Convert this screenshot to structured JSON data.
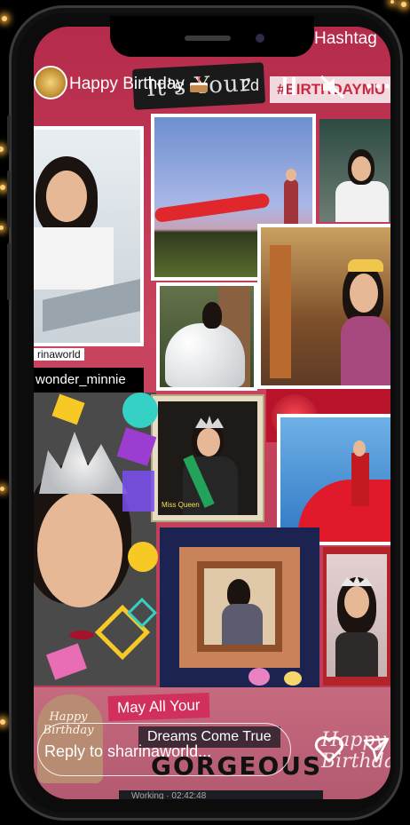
{
  "story": {
    "title": "Happy Birthday",
    "time": "2d",
    "hashtag_sticker": "#BIRTHDAYMU",
    "hashtag_peek": "Hashtag",
    "sticker_heading": "It's Your",
    "tag_user_1": "rinaworld",
    "tag_user_2": "wonder_minnie",
    "banner_1": "May All Your",
    "banner_2": "Dreams Come True",
    "banner_3": "GORGEOUS",
    "corner_text": "Happy Birthday",
    "cake_text": "Happy Birthday",
    "sash_text": "Miss Queen",
    "status_strip": "Working · 02:42:48"
  },
  "reply": {
    "placeholder": "Reply to sharinaworld..."
  },
  "icons": {
    "pause": "pause-icon",
    "mute": "mute-icon",
    "more": "more-icon",
    "heart": "heart-icon",
    "send": "send-icon"
  },
  "colors": {
    "background": "#c03a55",
    "accent_red": "#d12f5c",
    "sticker_text": "#c7283f"
  }
}
